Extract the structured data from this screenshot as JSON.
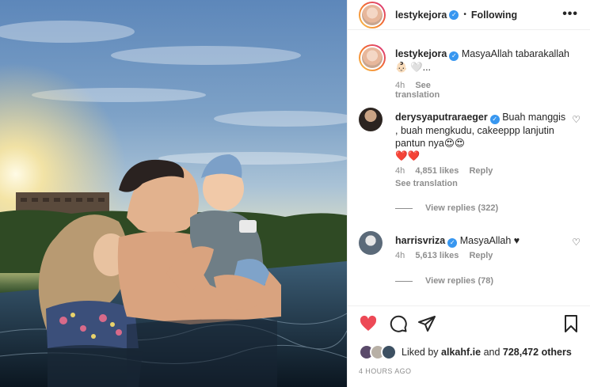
{
  "post": {
    "author": "lestykejora",
    "follow_status": "Following",
    "more_label": "•••"
  },
  "caption": {
    "username": "lestykejora",
    "text": "MasyaAllah tabarakallah",
    "emoji_line": "👶🏻 🤍...",
    "time": "4h",
    "see_translation": "See translation"
  },
  "comments": [
    {
      "username": "derysyaputraraeger",
      "text": "Buah manggis , buah mengkudu, cakeeppp lanjutin pantun nya😍😍",
      "text_line2": "❤️❤️",
      "time": "4h",
      "likes": "4,851 likes",
      "reply": "Reply",
      "see_translation": "See translation",
      "view_replies": "View replies (322)"
    },
    {
      "username": "harrisvriza",
      "text": "MasyaAllah ♥",
      "time": "4h",
      "likes": "5,613 likes",
      "reply": "Reply",
      "view_replies": "View replies (78)"
    }
  ],
  "likes_summary": {
    "prefix": "Liked by",
    "user": "alkahf.ie",
    "joiner": "and",
    "count": "728,472 others"
  },
  "timestamp": "4 HOURS AGO",
  "icons": {
    "like": "heart-icon",
    "comment": "comment-icon",
    "share": "share-icon",
    "save": "bookmark-icon"
  },
  "colors": {
    "like_red": "#ed4956",
    "verified_blue": "#3897f0",
    "muted_text": "#8e8e8e"
  }
}
